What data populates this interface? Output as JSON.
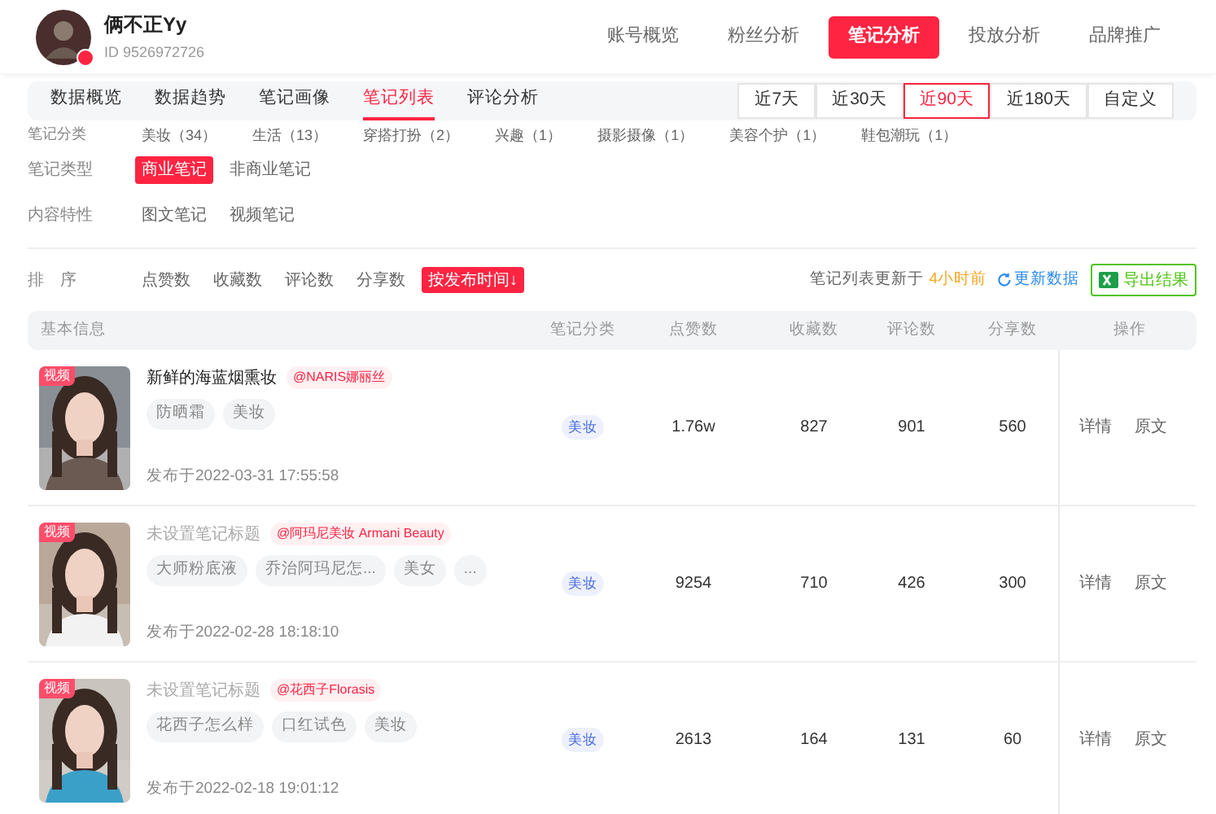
{
  "account": {
    "name": "俩不正Yy",
    "id": "ID 9526972726"
  },
  "main_nav": [
    {
      "label": "账号概览",
      "selected": false
    },
    {
      "label": "粉丝分析",
      "selected": false
    },
    {
      "label": "笔记分析",
      "selected": true
    },
    {
      "label": "投放分析",
      "selected": false
    },
    {
      "label": "品牌推广",
      "selected": false
    }
  ],
  "sub_tabs": [
    {
      "label": "数据概览",
      "selected": false
    },
    {
      "label": "数据趋势",
      "selected": false
    },
    {
      "label": "笔记画像",
      "selected": false
    },
    {
      "label": "笔记列表",
      "selected": true
    },
    {
      "label": "评论分析",
      "selected": false
    }
  ],
  "date_ranges": [
    {
      "label": "近7天",
      "selected": false
    },
    {
      "label": "近30天",
      "selected": false
    },
    {
      "label": "近90天",
      "selected": true
    },
    {
      "label": "近180天",
      "selected": false
    },
    {
      "label": "自定义",
      "selected": false
    }
  ],
  "filters": [
    {
      "label": "笔记分类",
      "options": [
        {
          "label": "美妆（34）",
          "selected": false
        },
        {
          "label": "生活（13）",
          "selected": false
        },
        {
          "label": "穿搭打扮（2）",
          "selected": false
        },
        {
          "label": "兴趣（1）",
          "selected": false
        },
        {
          "label": "摄影摄像（1）",
          "selected": false
        },
        {
          "label": "美容个护（1）",
          "selected": false
        },
        {
          "label": "鞋包潮玩（1）",
          "selected": false
        }
      ]
    },
    {
      "label": "笔记类型",
      "options": [
        {
          "label": "商业笔记",
          "selected": true
        },
        {
          "label": "非商业笔记",
          "selected": false
        }
      ]
    },
    {
      "label": "内容特性",
      "options": [
        {
          "label": "图文笔记",
          "selected": false
        },
        {
          "label": "视频笔记",
          "selected": false
        }
      ]
    }
  ],
  "sort": {
    "label": "排　序",
    "options": [
      {
        "label": "点赞数",
        "selected": false
      },
      {
        "label": "收藏数",
        "selected": false
      },
      {
        "label": "评论数",
        "selected": false
      },
      {
        "label": "分享数",
        "selected": false
      },
      {
        "label": "按发布时间↓",
        "selected": true
      }
    ]
  },
  "update_info": {
    "prefix": "笔记列表更新于",
    "time": "4小时前",
    "refresh": "更新数据",
    "export": "导出结果"
  },
  "table": {
    "columns": [
      "基本信息",
      "笔记分类",
      "点赞数",
      "收藏数",
      "评论数",
      "分享数",
      "操作"
    ],
    "rows": [
      {
        "badge": "视频",
        "title": "新鲜的海蓝烟熏妆",
        "untitled": false,
        "mention": "@NARIS娜丽丝",
        "tags": [
          "防晒霜",
          "美妆"
        ],
        "date": "发布于2022-03-31 17:55:58",
        "category": "美妆",
        "likes": "1.76w",
        "collects": "827",
        "comments": "901",
        "shares": "560",
        "actions": [
          "详情",
          "原文"
        ]
      },
      {
        "badge": "视频",
        "title": "未设置笔记标题",
        "untitled": true,
        "mention": "@阿玛尼美妆 Armani Beauty",
        "tags": [
          "大师粉底液",
          "乔治阿玛尼怎...",
          "美女",
          "..."
        ],
        "date": "发布于2022-02-28 18:18:10",
        "category": "美妆",
        "likes": "9254",
        "collects": "710",
        "comments": "426",
        "shares": "300",
        "actions": [
          "详情",
          "原文"
        ]
      },
      {
        "badge": "视频",
        "title": "未设置笔记标题",
        "untitled": true,
        "mention": "@花西子Florasis",
        "tags": [
          "花西子怎么样",
          "口红试色",
          "美妆"
        ],
        "date": "发布于2022-02-18 19:01:12",
        "category": "美妆",
        "likes": "2613",
        "collects": "164",
        "comments": "131",
        "shares": "60",
        "actions": [
          "详情",
          "原文"
        ]
      }
    ]
  }
}
